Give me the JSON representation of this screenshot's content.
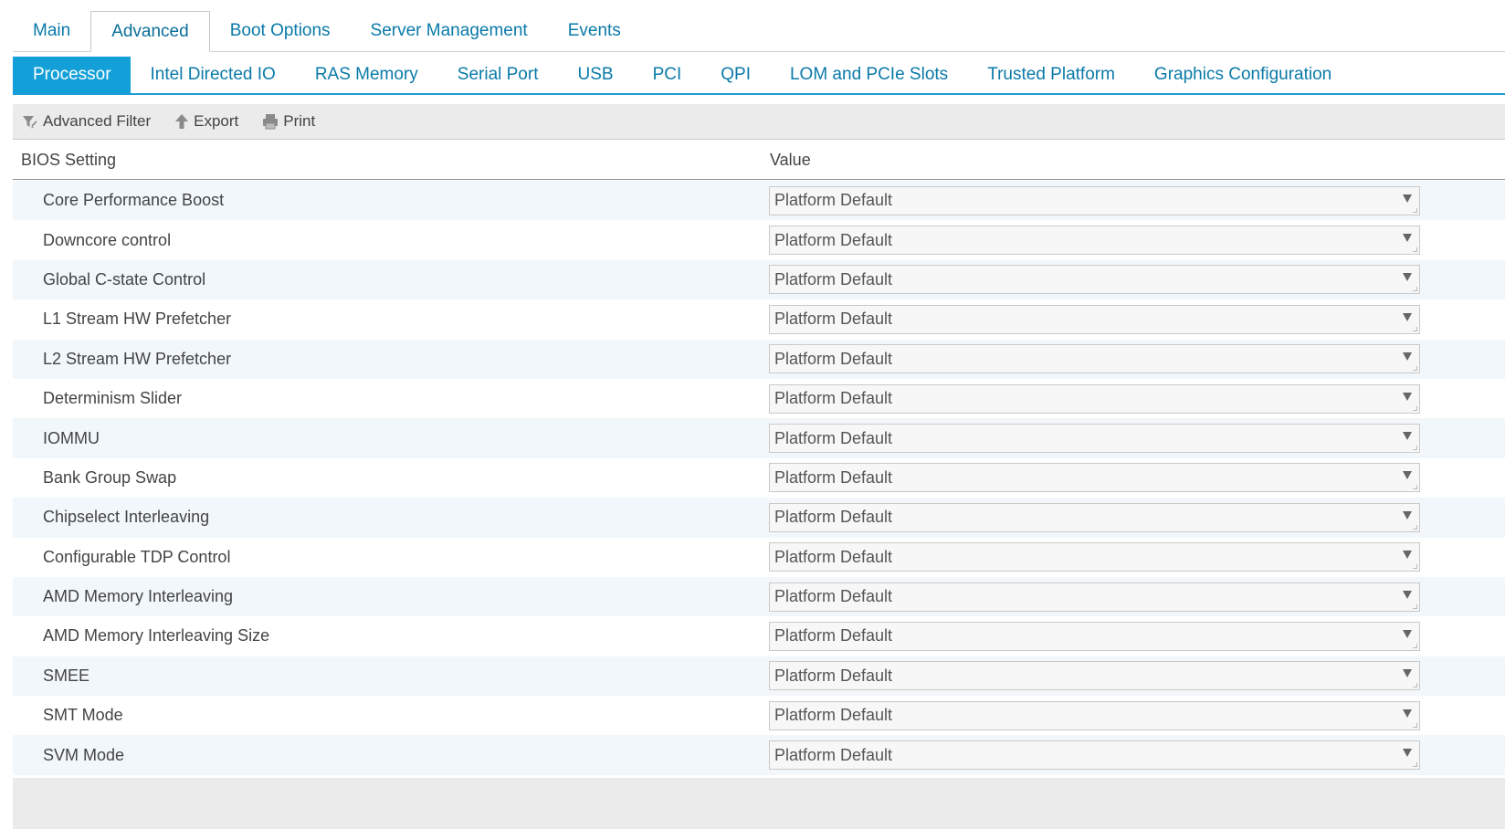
{
  "top_tabs": [
    {
      "label": "Main",
      "active": false
    },
    {
      "label": "Advanced",
      "active": true
    },
    {
      "label": "Boot Options",
      "active": false
    },
    {
      "label": "Server Management",
      "active": false
    },
    {
      "label": "Events",
      "active": false
    }
  ],
  "sub_tabs": [
    {
      "label": "Processor",
      "active": true
    },
    {
      "label": "Intel Directed IO",
      "active": false
    },
    {
      "label": "RAS Memory",
      "active": false
    },
    {
      "label": "Serial Port",
      "active": false
    },
    {
      "label": "USB",
      "active": false
    },
    {
      "label": "PCI",
      "active": false
    },
    {
      "label": "QPI",
      "active": false
    },
    {
      "label": "LOM and PCIe Slots",
      "active": false
    },
    {
      "label": "Trusted Platform",
      "active": false
    },
    {
      "label": "Graphics Configuration",
      "active": false
    }
  ],
  "toolbar": {
    "filter_label": "Advanced Filter",
    "export_label": "Export",
    "print_label": "Print"
  },
  "table": {
    "col_setting": "BIOS Setting",
    "col_value": "Value",
    "rows": [
      {
        "setting": "Core Performance Boost",
        "value": "Platform Default"
      },
      {
        "setting": "Downcore control",
        "value": "Platform Default"
      },
      {
        "setting": "Global C-state Control",
        "value": "Platform Default"
      },
      {
        "setting": "L1 Stream HW Prefetcher",
        "value": "Platform Default"
      },
      {
        "setting": "L2 Stream HW Prefetcher",
        "value": "Platform Default"
      },
      {
        "setting": "Determinism Slider",
        "value": "Platform Default"
      },
      {
        "setting": "IOMMU",
        "value": "Platform Default"
      },
      {
        "setting": "Bank Group Swap",
        "value": "Platform Default"
      },
      {
        "setting": "Chipselect Interleaving",
        "value": "Platform Default"
      },
      {
        "setting": "Configurable TDP Control",
        "value": "Platform Default"
      },
      {
        "setting": "AMD Memory Interleaving",
        "value": "Platform Default"
      },
      {
        "setting": "AMD Memory Interleaving Size",
        "value": "Platform Default"
      },
      {
        "setting": "SMEE",
        "value": "Platform Default"
      },
      {
        "setting": "SMT Mode",
        "value": "Platform Default"
      },
      {
        "setting": "SVM Mode",
        "value": "Platform Default"
      }
    ]
  },
  "colors": {
    "accent": "#13a0d8",
    "link": "#0a7aa8",
    "row_alt": "#f1f7fb"
  }
}
